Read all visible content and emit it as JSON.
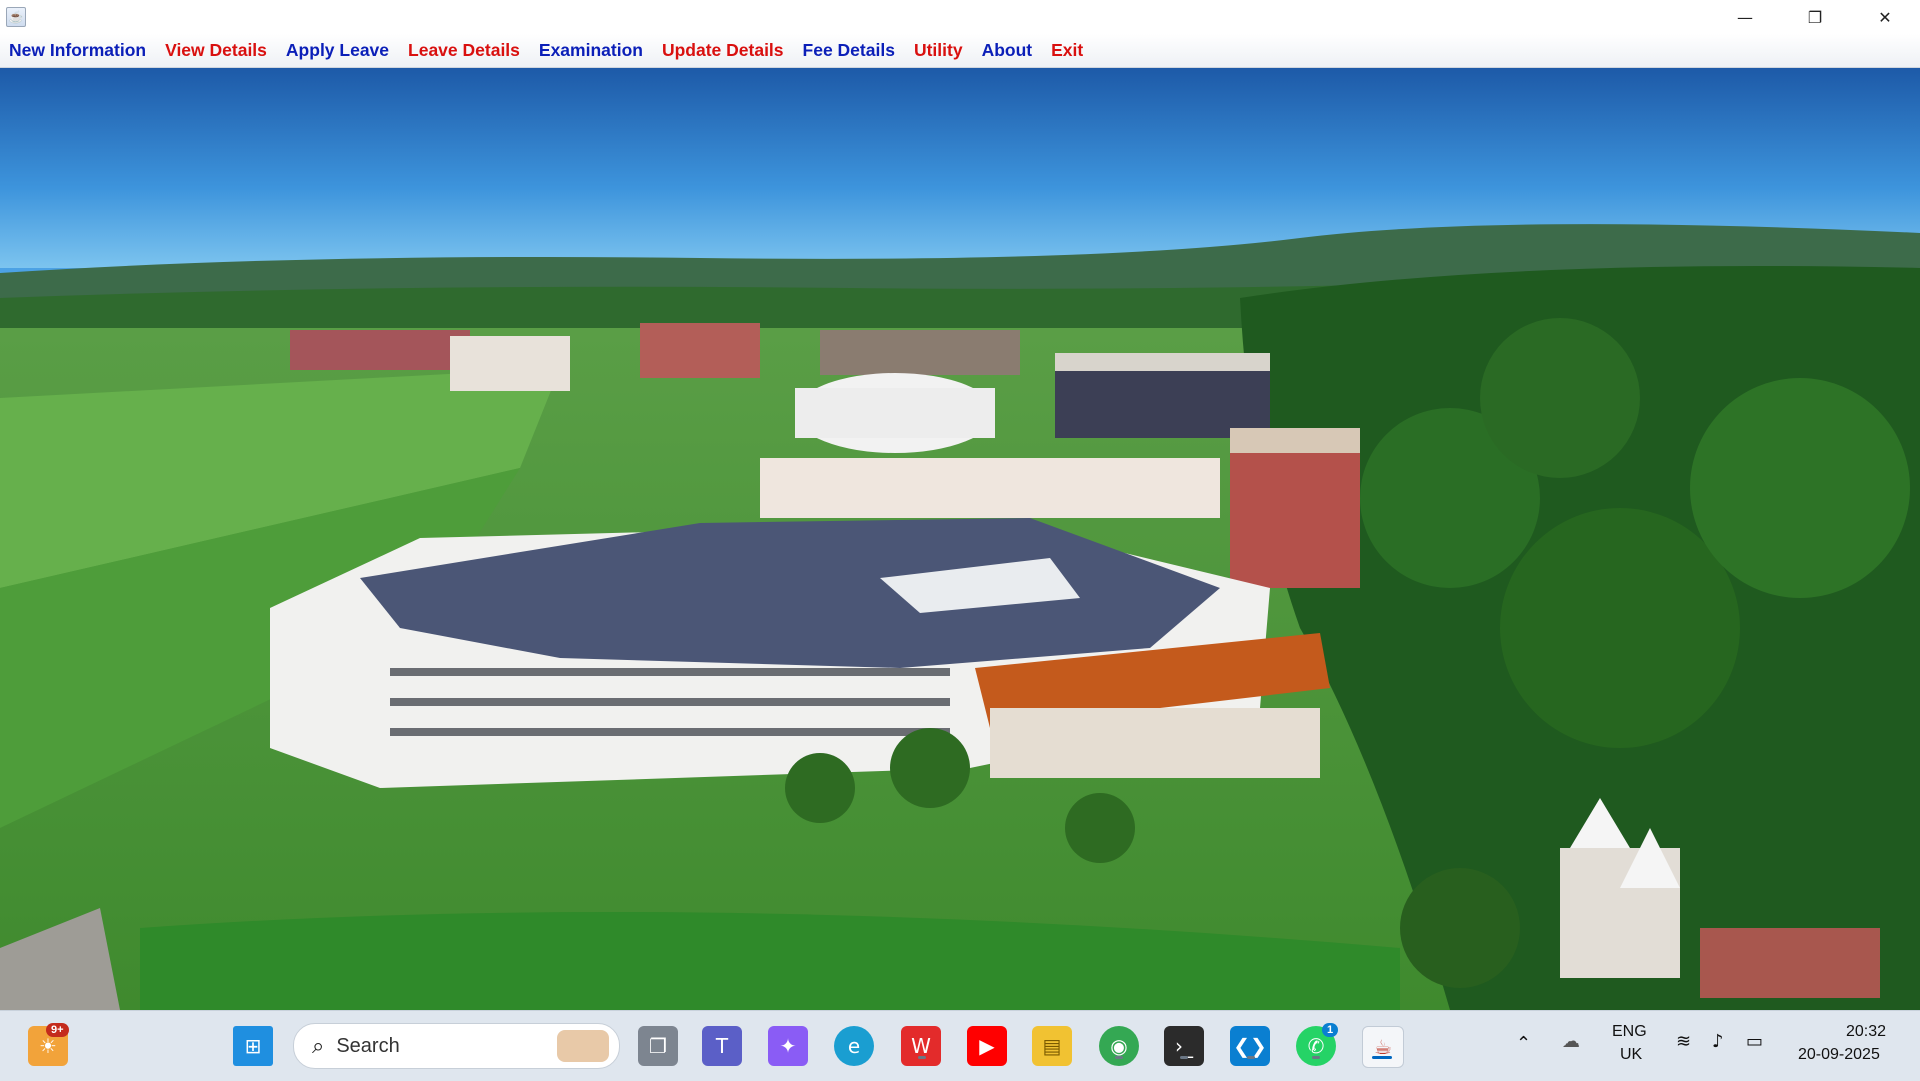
{
  "window": {
    "controls": {
      "minimize": "—",
      "restore": "❐",
      "close": "✕"
    }
  },
  "menu": [
    {
      "label": "New Information",
      "color": "#0b1fb8"
    },
    {
      "label": "View Details",
      "color": "#d9100f"
    },
    {
      "label": "Apply Leave",
      "color": "#0b1fb8"
    },
    {
      "label": "Leave Details",
      "color": "#d9100f"
    },
    {
      "label": "Examination",
      "color": "#0b1fb8"
    },
    {
      "label": "Update Details",
      "color": "#d9100f"
    },
    {
      "label": "Fee Details",
      "color": "#0b1fb8"
    },
    {
      "label": "Utility",
      "color": "#d9100f"
    },
    {
      "label": "About",
      "color": "#0b1fb8"
    },
    {
      "label": "Exit",
      "color": "#d9100f"
    }
  ],
  "taskbar": {
    "widgets_badge": "9+",
    "search_placeholder": "Search",
    "whatsapp_badge": "1",
    "language": "ENG",
    "region": "UK",
    "time": "20:32",
    "date": "20-09-2025",
    "icons": [
      "widgets-icon",
      "windows-start-icon",
      "search-icon",
      "task-view-icon",
      "teams-icon",
      "copilot-icon",
      "edge-icon",
      "wps-icon",
      "youtube-icon",
      "file-explorer-icon",
      "chrome-icon",
      "terminal-icon",
      "vscode-icon",
      "whatsapp-icon",
      "java-icon"
    ]
  }
}
